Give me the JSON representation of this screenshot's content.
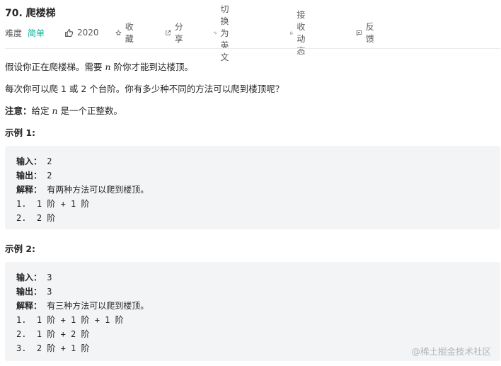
{
  "problem": {
    "title": "70. 爬楼梯"
  },
  "meta": {
    "difficulty_label": "难度",
    "difficulty_value": "简单",
    "likes": "2020",
    "favorite": "收藏",
    "share": "分享",
    "switch_lang": "切换为英文",
    "notify": "接收动态",
    "feedback": "反馈",
    "icons": [
      "thumbs-up-icon",
      "star-icon",
      "share-icon",
      "translate-icon",
      "bell-icon",
      "feedback-icon"
    ]
  },
  "desc": {
    "p1_a": "假设你正在爬楼梯。需要 ",
    "p1_n": "n",
    "p1_b": " 阶你才能到达楼顶。",
    "p2": "每次你可以爬 1 或 2 个台阶。你有多少种不同的方法可以爬到楼顶呢？",
    "p3_label": "注意：",
    "p3_a": "给定 ",
    "p3_n": "n",
    "p3_b": " 是一个正整数。"
  },
  "example1": {
    "heading": "示例 1:",
    "input_label": "输入：",
    "input_value": " 2",
    "output_label": "输出：",
    "output_value": " 2",
    "explain_label": "解释：",
    "explain_value": " 有两种方法可以爬到楼顶。",
    "steps": [
      "1.  1 阶 + 1 阶",
      "2.  2 阶"
    ]
  },
  "example2": {
    "heading": "示例 2:",
    "input_label": "输入：",
    "input_value": " 3",
    "output_label": "输出：",
    "output_value": " 3",
    "explain_label": "解释：",
    "explain_value": " 有三种方法可以爬到楼顶。",
    "steps": [
      "1.  1 阶 + 1 阶 + 1 阶",
      "2.  1 阶 + 2 阶",
      "3.  2 阶 + 1 阶"
    ]
  },
  "watermark": "@稀土掘金技术社区",
  "colors": {
    "easy": "#00af9b",
    "code_bg": "#f3f4f5",
    "text": "#262626"
  }
}
